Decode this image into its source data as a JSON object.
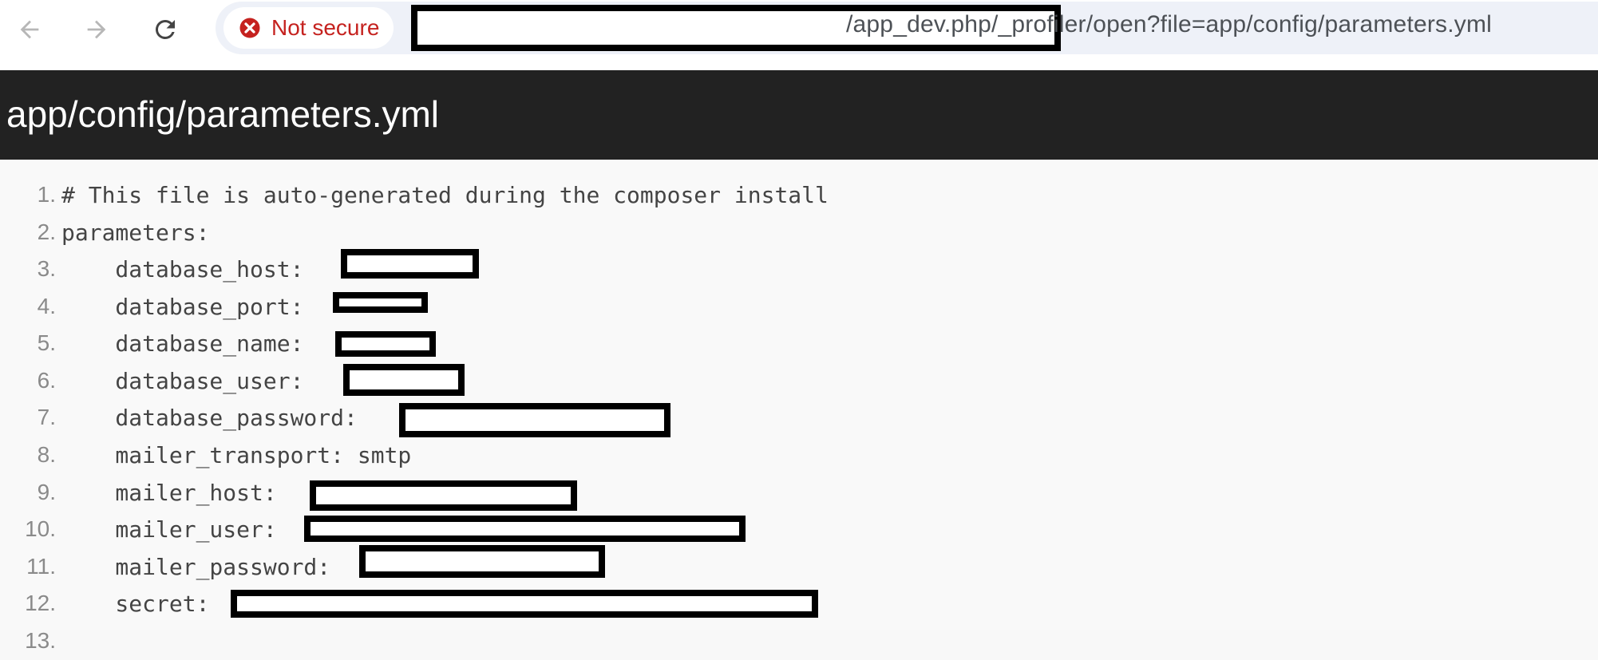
{
  "browser": {
    "back_icon": "arrow-left-icon",
    "forward_icon": "arrow-right-icon",
    "reload_icon": "reload-icon",
    "security_icon": "error-circle-icon",
    "security_label": "Not secure",
    "security_color": "#c5221f",
    "url_path": "/app_dev.php/_profiler/open?file=app/config/parameters.yml"
  },
  "page": {
    "title": "app/config/parameters.yml"
  },
  "code": {
    "lines": [
      {
        "num": "1.",
        "text": "# This file is auto-generated during the composer install"
      },
      {
        "num": "2.",
        "text": "parameters:"
      },
      {
        "num": "3.",
        "text": "    database_host:"
      },
      {
        "num": "4.",
        "text": "    database_port:"
      },
      {
        "num": "5.",
        "text": "    database_name:"
      },
      {
        "num": "6.",
        "text": "    database_user:"
      },
      {
        "num": "7.",
        "text": "    database_password:"
      },
      {
        "num": "8.",
        "text": "    mailer_transport: smtp"
      },
      {
        "num": "9.",
        "text": "    mailer_host:"
      },
      {
        "num": "10.",
        "text": "    mailer_user:"
      },
      {
        "num": "11.",
        "text": "    mailer_password:"
      },
      {
        "num": "12.",
        "text": "    secret:"
      },
      {
        "num": "13.",
        "text": ""
      }
    ]
  }
}
